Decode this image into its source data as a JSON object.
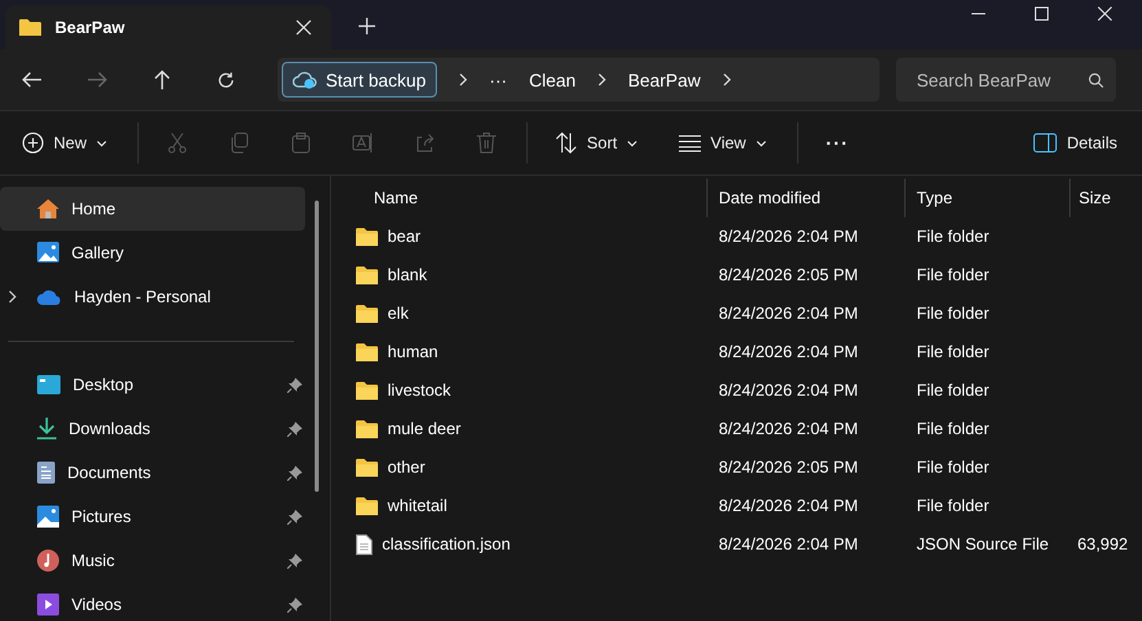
{
  "tabs": [
    {
      "title": "BearPaw"
    }
  ],
  "address": {
    "backup": "Start backup",
    "overflow": "···",
    "crumbs": [
      "Clean",
      "BearPaw"
    ]
  },
  "search": {
    "placeholder": "Search BearPaw"
  },
  "toolbar": [
    {
      "label": "New",
      "disabled": false
    },
    {
      "disabled": true
    },
    {
      "disabled": true
    },
    {
      "disabled": true
    },
    {
      "disabled": true
    },
    {
      "disabled": true
    },
    {
      "disabled": true
    },
    {
      "label": "Sort",
      "disabled": false
    },
    {
      "label": "View",
      "disabled": false
    },
    {
      "label": "···",
      "disabled": false
    }
  ],
  "details": "Details",
  "sidebar_top": [
    {
      "label": "Home",
      "selected": true,
      "expandable": false
    },
    {
      "label": "Gallery",
      "selected": false,
      "expandable": false
    },
    {
      "label": "Hayden - Personal",
      "selected": false,
      "expandable": true
    }
  ],
  "quick_access": [
    {
      "label": "Desktop",
      "pinned": true
    },
    {
      "label": "Downloads",
      "pinned": true
    },
    {
      "label": "Documents",
      "pinned": true
    },
    {
      "label": "Pictures",
      "pinned": true
    },
    {
      "label": "Music",
      "pinned": true
    },
    {
      "label": "Videos",
      "pinned": true
    }
  ],
  "columns": [
    "Name",
    "Date modified",
    "Type",
    "Size"
  ],
  "files": [
    {
      "kind": "folder",
      "name": "bear",
      "date": "8/24/2026 2:04 PM",
      "type": "File folder"
    },
    {
      "kind": "folder",
      "name": "blank",
      "date": "8/24/2026 2:05 PM",
      "type": "File folder"
    },
    {
      "kind": "folder",
      "name": "elk",
      "date": "8/24/2026 2:04 PM",
      "type": "File folder"
    },
    {
      "kind": "folder",
      "name": "human",
      "date": "8/24/2026 2:04 PM",
      "type": "File folder"
    },
    {
      "kind": "folder",
      "name": "livestock",
      "date": "8/24/2026 2:04 PM",
      "type": "File folder"
    },
    {
      "kind": "folder",
      "name": "mule deer",
      "date": "8/24/2026 2:04 PM",
      "type": "File folder"
    },
    {
      "kind": "folder",
      "name": "other",
      "date": "8/24/2026 2:05 PM",
      "type": "File folder"
    },
    {
      "kind": "folder",
      "name": "whitetail",
      "date": "8/24/2026 2:04 PM",
      "type": "File folder"
    },
    {
      "kind": "file",
      "name": "classification.json",
      "date": "8/24/2026 2:04 PM",
      "type": "JSON Source File",
      "size": "63,992"
    }
  ]
}
